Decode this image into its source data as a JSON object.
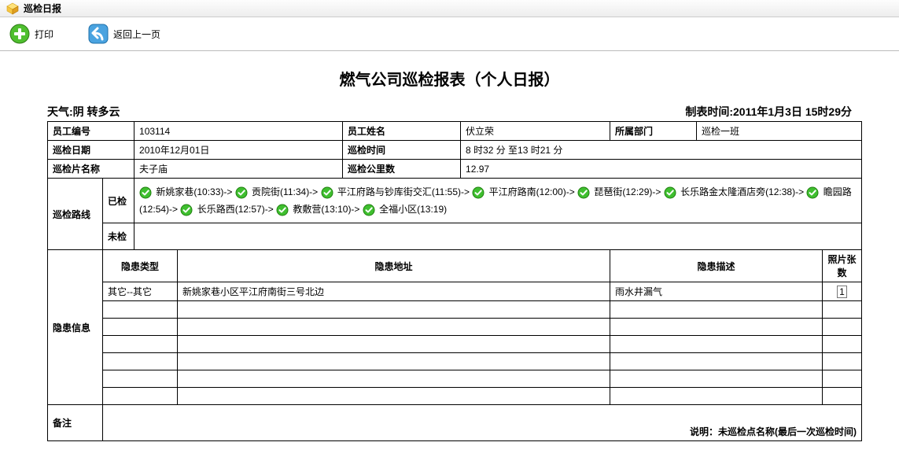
{
  "header": {
    "title": "巡检日报"
  },
  "toolbar": {
    "print": "打印",
    "back": "返回上一页"
  },
  "page_title": "燃气公司巡检报表（个人日报）",
  "meta": {
    "weather_label": "天气:",
    "weather": "阴 转多云",
    "gen_time_label": "制表时间:",
    "gen_time": "2011年1月3日 15时29分"
  },
  "labels": {
    "emp_id": "员工编号",
    "emp_name": "员工姓名",
    "dept": "所属部门",
    "patrol_date": "巡检日期",
    "patrol_time": "巡检时间",
    "area_name": "巡检片名称",
    "km": "巡检公里数",
    "route": "巡检路线",
    "checked": "已检",
    "unchecked": "未检",
    "hazard_info": "隐患信息",
    "hazard_type": "隐患类型",
    "hazard_addr": "隐患地址",
    "hazard_desc": "隐患描述",
    "photo_count": "照片张数",
    "remark": "备注"
  },
  "values": {
    "emp_id": "103114",
    "emp_name": "伏立荣",
    "dept": "巡检一班",
    "patrol_date": "2010年12月01日",
    "patrol_time": "8 时32 分 至13 时21 分",
    "area_name": "夫子庙",
    "km": "12.97"
  },
  "route_points": [
    {
      "name": "新姚家巷",
      "time": "10:33"
    },
    {
      "name": "贡院街",
      "time": "11:34"
    },
    {
      "name": "平江府路与钞库街交汇",
      "time": "11:55"
    },
    {
      "name": "平江府路南",
      "time": "12:00"
    },
    {
      "name": "琵琶街",
      "time": "12:29"
    },
    {
      "name": "长乐路金太隆酒店旁",
      "time": "12:38"
    },
    {
      "name": "瞻园路",
      "time": "12:54"
    },
    {
      "name": "长乐路西",
      "time": "12:57"
    },
    {
      "name": "教敷营",
      "time": "13:10"
    },
    {
      "name": "全福小区",
      "time": "13:19"
    }
  ],
  "hazards": [
    {
      "type": "其它--其它",
      "addr": "新姚家巷小区平江府南街三号北边",
      "desc": "雨水井漏气",
      "photos": "1"
    }
  ],
  "footnote": "说明：未巡检点名称(最后一次巡检时间)"
}
